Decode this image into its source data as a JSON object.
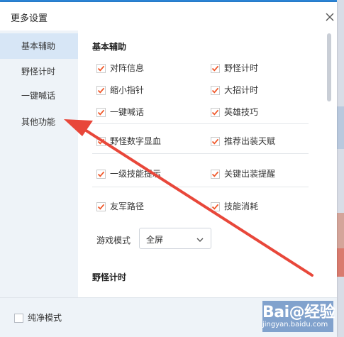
{
  "dialog": {
    "title": "更多设置",
    "close_icon": "close-icon"
  },
  "sidebar": {
    "items": [
      {
        "label": "基本辅助",
        "active": true
      },
      {
        "label": "野怪计时",
        "active": false
      },
      {
        "label": "一键喊话",
        "active": false
      },
      {
        "label": "其他功能",
        "active": false
      }
    ]
  },
  "content": {
    "section1_title": "基本辅助",
    "section2_title": "野怪计时",
    "options": [
      {
        "label": "对阵信息",
        "checked": true
      },
      {
        "label": "野怪计时",
        "checked": true
      },
      {
        "label": "缩小指针",
        "checked": true
      },
      {
        "label": "大招计时",
        "checked": true
      },
      {
        "label": "一键喊话",
        "checked": true
      },
      {
        "label": "英雄技巧",
        "checked": true
      },
      {
        "label": "野怪数字显血",
        "checked": true
      },
      {
        "label": "推荐出装天赋",
        "checked": true
      },
      {
        "label": "一级技能提示",
        "checked": true
      },
      {
        "label": "关键出装提醒",
        "checked": true
      },
      {
        "label": "友军路径",
        "checked": true
      },
      {
        "label": "技能消耗",
        "checked": true
      }
    ],
    "game_mode_label": "游戏模式",
    "game_mode_value": "全屏"
  },
  "footer": {
    "pure_mode_label": "纯净模式",
    "pure_mode_checked": false
  },
  "watermark": {
    "main": "Bai@经验",
    "sub": "jingyan.baidu.com"
  },
  "colors": {
    "accent": "#2b84d6",
    "check": "#f0582a",
    "sidebar_bg": "#eef3f8",
    "sidebar_active": "#d7e6f6",
    "arrow": "#e8473a"
  }
}
